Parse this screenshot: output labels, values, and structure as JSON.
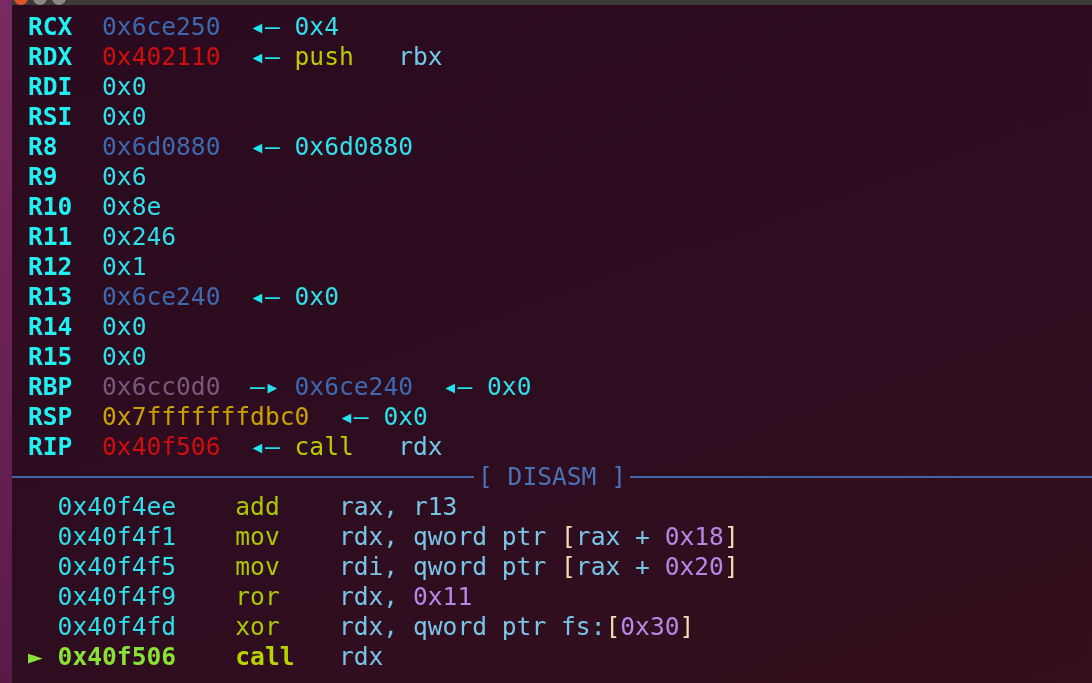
{
  "registers": [
    {
      "name": "RCX",
      "value": "0x6ce250",
      "kind": "data",
      "chain": [
        {
          "text": "◂—",
          "kind": "arrow"
        },
        {
          "text": "0x4",
          "kind": "plain"
        }
      ]
    },
    {
      "name": "RDX",
      "value": "0x402110",
      "kind": "code",
      "chain": [
        {
          "text": "◂—",
          "kind": "arrow"
        },
        {
          "text": "push",
          "kind": "mnemonic"
        },
        {
          "text": "rbx",
          "kind": "operand"
        }
      ]
    },
    {
      "name": "RDI",
      "value": "0x0",
      "kind": "plain"
    },
    {
      "name": "RSI",
      "value": "0x0",
      "kind": "plain"
    },
    {
      "name": "R8",
      "value": "0x6d0880",
      "kind": "data",
      "chain": [
        {
          "text": "◂—",
          "kind": "arrow"
        },
        {
          "text": "0x6d0880",
          "kind": "plain"
        }
      ]
    },
    {
      "name": "R9",
      "value": "0x6",
      "kind": "plain"
    },
    {
      "name": "R10",
      "value": "0x8e",
      "kind": "plain"
    },
    {
      "name": "R11",
      "value": "0x246",
      "kind": "plain"
    },
    {
      "name": "R12",
      "value": "0x1",
      "kind": "plain"
    },
    {
      "name": "R13",
      "value": "0x6ce240",
      "kind": "data",
      "chain": [
        {
          "text": "◂—",
          "kind": "arrow"
        },
        {
          "text": "0x0",
          "kind": "plain"
        }
      ]
    },
    {
      "name": "R14",
      "value": "0x0",
      "kind": "plain"
    },
    {
      "name": "R15",
      "value": "0x0",
      "kind": "plain"
    },
    {
      "name": "RBP",
      "value": "0x6cc0d0",
      "kind": "heap",
      "chain": [
        {
          "text": "—▸",
          "kind": "arrow"
        },
        {
          "text": "0x6ce240",
          "kind": "data"
        },
        {
          "text": "◂—",
          "kind": "arrow"
        },
        {
          "text": "0x0",
          "kind": "plain"
        }
      ]
    },
    {
      "name": "RSP",
      "value": "0x7fffffffdbc0",
      "kind": "stack",
      "chain": [
        {
          "text": "◂—",
          "kind": "arrow"
        },
        {
          "text": "0x0",
          "kind": "plain"
        }
      ]
    },
    {
      "name": "RIP",
      "value": "0x40f506",
      "kind": "code",
      "chain": [
        {
          "text": "◂—",
          "kind": "arrow"
        },
        {
          "text": "call",
          "kind": "mnemonic"
        },
        {
          "text": "rdx",
          "kind": "operand"
        }
      ]
    }
  ],
  "disasm": {
    "title": "[ DISASM ]",
    "lines": [
      {
        "current": false,
        "address": "0x40f4ee",
        "mnemonic": "add",
        "operands": [
          {
            "text": "rax, r13",
            "kind": "reg"
          }
        ]
      },
      {
        "current": false,
        "address": "0x40f4f1",
        "mnemonic": "mov",
        "operands": [
          {
            "text": "rdx, qword ptr ",
            "kind": "reg"
          },
          {
            "text": "[",
            "kind": "bracket"
          },
          {
            "text": "rax + ",
            "kind": "reg"
          },
          {
            "text": "0x18",
            "kind": "number"
          },
          {
            "text": "]",
            "kind": "bracket"
          }
        ]
      },
      {
        "current": false,
        "address": "0x40f4f5",
        "mnemonic": "mov",
        "operands": [
          {
            "text": "rdi, qword ptr ",
            "kind": "reg"
          },
          {
            "text": "[",
            "kind": "bracket"
          },
          {
            "text": "rax + ",
            "kind": "reg"
          },
          {
            "text": "0x20",
            "kind": "number"
          },
          {
            "text": "]",
            "kind": "bracket"
          }
        ]
      },
      {
        "current": false,
        "address": "0x40f4f9",
        "mnemonic": "ror",
        "operands": [
          {
            "text": "rdx, ",
            "kind": "reg"
          },
          {
            "text": "0x11",
            "kind": "number"
          }
        ]
      },
      {
        "current": false,
        "address": "0x40f4fd",
        "mnemonic": "xor",
        "operands": [
          {
            "text": "rdx, qword ptr fs:",
            "kind": "reg"
          },
          {
            "text": "[",
            "kind": "bracket"
          },
          {
            "text": "0x30",
            "kind": "number"
          },
          {
            "text": "]",
            "kind": "bracket"
          }
        ]
      },
      {
        "current": true,
        "marker": "►",
        "address": "0x40f506",
        "mnemonic": "call",
        "operands": [
          {
            "text": "rdx",
            "kind": "reg"
          }
        ]
      }
    ]
  }
}
